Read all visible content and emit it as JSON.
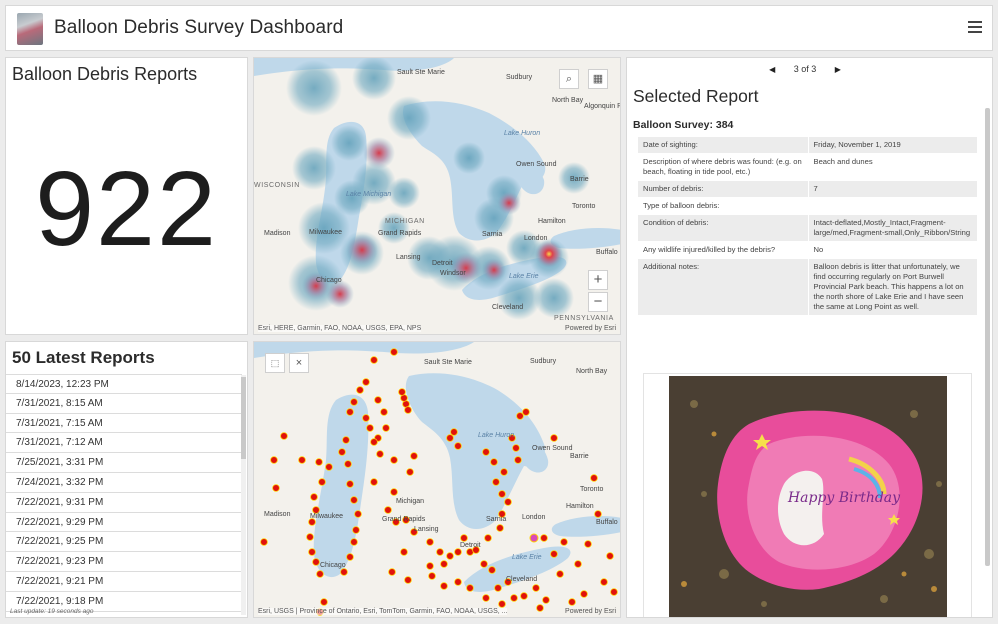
{
  "header": {
    "title": "Balloon Debris Survey Dashboard",
    "logo_icon": "balloon-photo-thumbnail",
    "menu_icon": "hamburger-menu-icon"
  },
  "indicator": {
    "title": "Balloon Debris Reports",
    "value": "922"
  },
  "list": {
    "title": "50 Latest Reports",
    "items": [
      "8/14/2023, 12:23 PM",
      "7/31/2021, 8:15 AM",
      "7/31/2021, 7:15 AM",
      "7/31/2021, 7:12 AM",
      "7/25/2021, 3:31 PM",
      "7/24/2021, 3:32 PM",
      "7/22/2021, 9:31 PM",
      "7/22/2021, 9:29 PM",
      "7/22/2021, 9:25 PM",
      "7/22/2021, 9:23 PM",
      "7/22/2021, 9:21 PM",
      "7/22/2021, 9:18 PM"
    ],
    "last_update": "Last update: 19 seconds ago"
  },
  "map_heat": {
    "labels": [
      "Sault Ste Marie",
      "Sudbury",
      "North Bay",
      "Algonquin Provincial Park",
      "Lake Huron",
      "Owen Sound",
      "Barrie",
      "WISCONSIN",
      "Lake Michigan",
      "MICHIGAN",
      "Toronto",
      "Hamilton",
      "Buffalo",
      "Madison",
      "Milwaukee",
      "Grand Rapids",
      "Lansing",
      "Sarnia",
      "London",
      "Detroit",
      "Windsor",
      "Lake Erie",
      "Chicago",
      "Cleveland",
      "PENNSYLVANIA"
    ],
    "attribution": "Esri, HERE, Garmin, FAO, NOAA, USGS, EPA, NPS",
    "powered": "Powered by Esri",
    "zoom_in": "+",
    "zoom_out": "−"
  },
  "map_points": {
    "labels": [
      "Sault Ste Marie",
      "Sudbury",
      "North Bay",
      "Lake Huron",
      "Owen Sound",
      "Barrie",
      "Michigan",
      "Toronto",
      "Hamilton",
      "Buffalo",
      "Madison",
      "Milwaukee",
      "Grand Rapids",
      "Lansing",
      "Sarnia",
      "London",
      "Detroit",
      "Lake Erie",
      "Chicago",
      "Cleveland"
    ],
    "attribution": "Esri, USGS | Province of Ontario, Esri, TomTom, Garmin, FAO, NOAA, USGS, ...",
    "powered": "Powered by Esri",
    "close": "×"
  },
  "details": {
    "pager": "3 of 3",
    "title": "Selected Report",
    "survey": "Balloon Survey: 384",
    "rows": [
      {
        "k": "Date of sighting:",
        "v": "Friday, November 1, 2019"
      },
      {
        "k": "Description of where debris was found: (e.g. on beach, floating in tide pool, etc.)",
        "v": "Beach and dunes"
      },
      {
        "k": "Number of debris:",
        "v": "7"
      },
      {
        "k": "Type of balloon debris:",
        "v": ""
      },
      {
        "k": "Condition of debris:",
        "v": "Intact-deflated,Mostly_Intact,Fragment-large/med,Fragment-small,Only_Ribbon/String"
      },
      {
        "k": "Any wildlife injured/killed by the debris?",
        "v": "No"
      },
      {
        "k": "Additional notes:",
        "v": "Balloon debris is litter that unfortunately, we find occurring regularly on Port Burwell Provincial Park beach. This happens a lot on the north shore of Lake Erie and I have seen the same at Long Point as well."
      }
    ],
    "photo_text": "Happy Birthday"
  },
  "colors": {
    "water": "#bfd8ea",
    "land": "#f3f1ec",
    "heat_base": "#6fa9c0",
    "heat_hot": "#d23a45",
    "point": "#e0120c"
  }
}
